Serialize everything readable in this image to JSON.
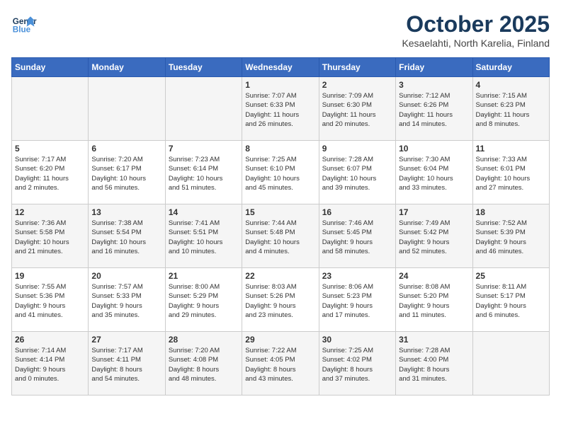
{
  "header": {
    "logo_line1": "General",
    "logo_line2": "Blue",
    "month": "October 2025",
    "location": "Kesaelahti, North Karelia, Finland"
  },
  "days_of_week": [
    "Sunday",
    "Monday",
    "Tuesday",
    "Wednesday",
    "Thursday",
    "Friday",
    "Saturday"
  ],
  "weeks": [
    [
      {
        "num": "",
        "info": ""
      },
      {
        "num": "",
        "info": ""
      },
      {
        "num": "",
        "info": ""
      },
      {
        "num": "1",
        "info": "Sunrise: 7:07 AM\nSunset: 6:33 PM\nDaylight: 11 hours\nand 26 minutes."
      },
      {
        "num": "2",
        "info": "Sunrise: 7:09 AM\nSunset: 6:30 PM\nDaylight: 11 hours\nand 20 minutes."
      },
      {
        "num": "3",
        "info": "Sunrise: 7:12 AM\nSunset: 6:26 PM\nDaylight: 11 hours\nand 14 minutes."
      },
      {
        "num": "4",
        "info": "Sunrise: 7:15 AM\nSunset: 6:23 PM\nDaylight: 11 hours\nand 8 minutes."
      }
    ],
    [
      {
        "num": "5",
        "info": "Sunrise: 7:17 AM\nSunset: 6:20 PM\nDaylight: 11 hours\nand 2 minutes."
      },
      {
        "num": "6",
        "info": "Sunrise: 7:20 AM\nSunset: 6:17 PM\nDaylight: 10 hours\nand 56 minutes."
      },
      {
        "num": "7",
        "info": "Sunrise: 7:23 AM\nSunset: 6:14 PM\nDaylight: 10 hours\nand 51 minutes."
      },
      {
        "num": "8",
        "info": "Sunrise: 7:25 AM\nSunset: 6:10 PM\nDaylight: 10 hours\nand 45 minutes."
      },
      {
        "num": "9",
        "info": "Sunrise: 7:28 AM\nSunset: 6:07 PM\nDaylight: 10 hours\nand 39 minutes."
      },
      {
        "num": "10",
        "info": "Sunrise: 7:30 AM\nSunset: 6:04 PM\nDaylight: 10 hours\nand 33 minutes."
      },
      {
        "num": "11",
        "info": "Sunrise: 7:33 AM\nSunset: 6:01 PM\nDaylight: 10 hours\nand 27 minutes."
      }
    ],
    [
      {
        "num": "12",
        "info": "Sunrise: 7:36 AM\nSunset: 5:58 PM\nDaylight: 10 hours\nand 21 minutes."
      },
      {
        "num": "13",
        "info": "Sunrise: 7:38 AM\nSunset: 5:54 PM\nDaylight: 10 hours\nand 16 minutes."
      },
      {
        "num": "14",
        "info": "Sunrise: 7:41 AM\nSunset: 5:51 PM\nDaylight: 10 hours\nand 10 minutes."
      },
      {
        "num": "15",
        "info": "Sunrise: 7:44 AM\nSunset: 5:48 PM\nDaylight: 10 hours\nand 4 minutes."
      },
      {
        "num": "16",
        "info": "Sunrise: 7:46 AM\nSunset: 5:45 PM\nDaylight: 9 hours\nand 58 minutes."
      },
      {
        "num": "17",
        "info": "Sunrise: 7:49 AM\nSunset: 5:42 PM\nDaylight: 9 hours\nand 52 minutes."
      },
      {
        "num": "18",
        "info": "Sunrise: 7:52 AM\nSunset: 5:39 PM\nDaylight: 9 hours\nand 46 minutes."
      }
    ],
    [
      {
        "num": "19",
        "info": "Sunrise: 7:55 AM\nSunset: 5:36 PM\nDaylight: 9 hours\nand 41 minutes."
      },
      {
        "num": "20",
        "info": "Sunrise: 7:57 AM\nSunset: 5:33 PM\nDaylight: 9 hours\nand 35 minutes."
      },
      {
        "num": "21",
        "info": "Sunrise: 8:00 AM\nSunset: 5:29 PM\nDaylight: 9 hours\nand 29 minutes."
      },
      {
        "num": "22",
        "info": "Sunrise: 8:03 AM\nSunset: 5:26 PM\nDaylight: 9 hours\nand 23 minutes."
      },
      {
        "num": "23",
        "info": "Sunrise: 8:06 AM\nSunset: 5:23 PM\nDaylight: 9 hours\nand 17 minutes."
      },
      {
        "num": "24",
        "info": "Sunrise: 8:08 AM\nSunset: 5:20 PM\nDaylight: 9 hours\nand 11 minutes."
      },
      {
        "num": "25",
        "info": "Sunrise: 8:11 AM\nSunset: 5:17 PM\nDaylight: 9 hours\nand 6 minutes."
      }
    ],
    [
      {
        "num": "26",
        "info": "Sunrise: 7:14 AM\nSunset: 4:14 PM\nDaylight: 9 hours\nand 0 minutes."
      },
      {
        "num": "27",
        "info": "Sunrise: 7:17 AM\nSunset: 4:11 PM\nDaylight: 8 hours\nand 54 minutes."
      },
      {
        "num": "28",
        "info": "Sunrise: 7:20 AM\nSunset: 4:08 PM\nDaylight: 8 hours\nand 48 minutes."
      },
      {
        "num": "29",
        "info": "Sunrise: 7:22 AM\nSunset: 4:05 PM\nDaylight: 8 hours\nand 43 minutes."
      },
      {
        "num": "30",
        "info": "Sunrise: 7:25 AM\nSunset: 4:02 PM\nDaylight: 8 hours\nand 37 minutes."
      },
      {
        "num": "31",
        "info": "Sunrise: 7:28 AM\nSunset: 4:00 PM\nDaylight: 8 hours\nand 31 minutes."
      },
      {
        "num": "",
        "info": ""
      }
    ]
  ]
}
